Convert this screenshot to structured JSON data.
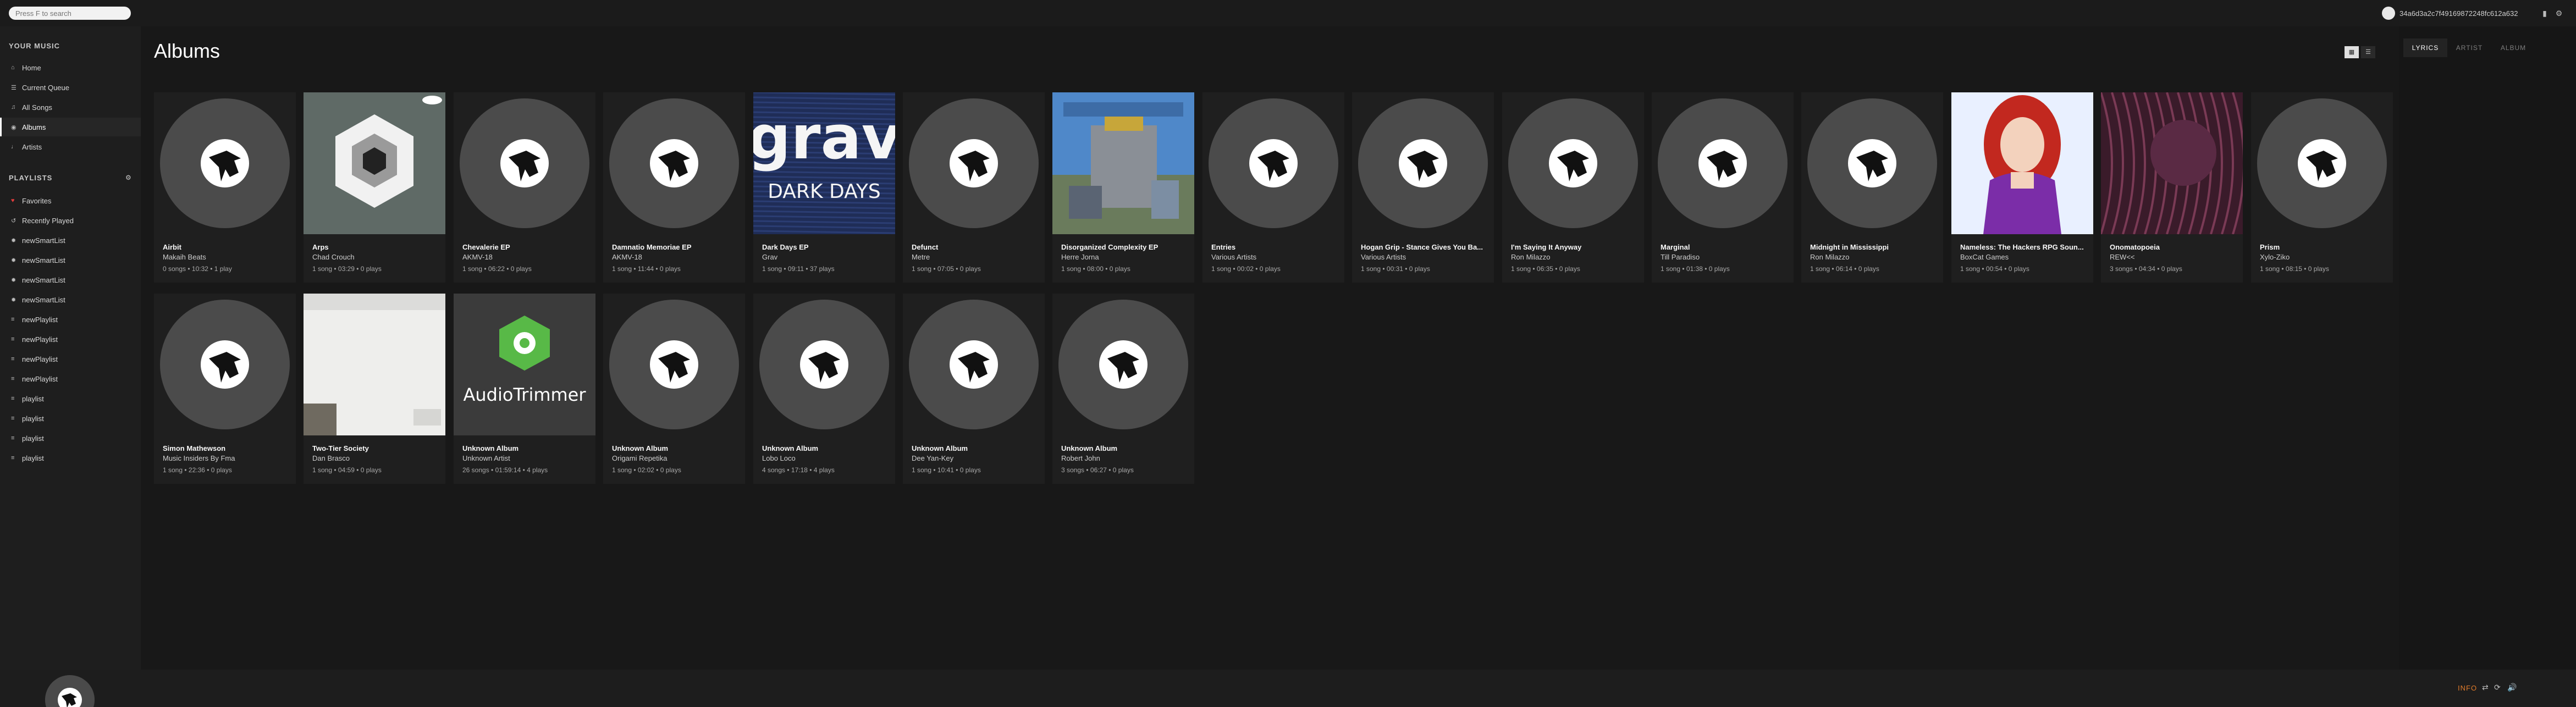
{
  "search": {
    "placeholder": "Press F to search"
  },
  "user": {
    "name": "34a6d3a2c7f49169872248fc612a632"
  },
  "sidebar": {
    "your_music_heading": "YOUR MUSIC",
    "music_items": [
      {
        "label": "Home",
        "icon": "home-icon"
      },
      {
        "label": "Current Queue",
        "icon": "queue-icon"
      },
      {
        "label": "All Songs",
        "icon": "music-note-icon"
      },
      {
        "label": "Albums",
        "icon": "album-icon",
        "active": true
      },
      {
        "label": "Artists",
        "icon": "microphone-icon"
      }
    ],
    "playlists_heading": "PLAYLISTS",
    "playlist_items": [
      {
        "label": "Favorites",
        "icon": "heart-icon"
      },
      {
        "label": "Recently Played",
        "icon": "history-icon"
      },
      {
        "label": "newSmartList",
        "icon": "smart-list-icon"
      },
      {
        "label": "newSmartList",
        "icon": "smart-list-icon"
      },
      {
        "label": "newSmartList",
        "icon": "smart-list-icon"
      },
      {
        "label": "newSmartList",
        "icon": "smart-list-icon"
      },
      {
        "label": "newPlaylist",
        "icon": "playlist-icon"
      },
      {
        "label": "newPlaylist",
        "icon": "playlist-icon"
      },
      {
        "label": "newPlaylist",
        "icon": "playlist-icon"
      },
      {
        "label": "newPlaylist",
        "icon": "playlist-icon"
      },
      {
        "label": "playlist",
        "icon": "playlist-icon"
      },
      {
        "label": "playlist",
        "icon": "playlist-icon"
      },
      {
        "label": "playlist",
        "icon": "playlist-icon"
      },
      {
        "label": "playlist",
        "icon": "playlist-icon"
      }
    ]
  },
  "main": {
    "title": "Albums",
    "albums": [
      {
        "title": "Airbit",
        "artist": "Makaih Beats",
        "meta": "0 songs • 10:32 • 1 play",
        "cover": "placeholder"
      },
      {
        "title": "Arps",
        "artist": "Chad Crouch",
        "meta": "1 song • 03:29 • 0 plays",
        "cover": "arps"
      },
      {
        "title": "Chevalerie EP",
        "artist": "AKMV-18",
        "meta": "1 song • 06:22 • 0 plays",
        "cover": "placeholder"
      },
      {
        "title": "Damnatio Memoriae EP",
        "artist": "AKMV-18",
        "meta": "1 song • 11:44 • 0 plays",
        "cover": "placeholder"
      },
      {
        "title": "Dark Days EP",
        "artist": "Grav",
        "meta": "1 song • 09:11 • 37 plays",
        "cover": "darkdays",
        "cover_text_top": "grav",
        "cover_text_bottom": "DARK DAYS"
      },
      {
        "title": "Defunct",
        "artist": "Metre",
        "meta": "1 song • 07:05 • 0 plays",
        "cover": "placeholder"
      },
      {
        "title": "Disorganized Complexity EP",
        "artist": "Herre Jorna",
        "meta": "1 song • 08:00 • 0 plays",
        "cover": "disorganized"
      },
      {
        "title": "Entries",
        "artist": "Various Artists",
        "meta": "1 song • 00:02 • 0 plays",
        "cover": "placeholder"
      },
      {
        "title": "Hogan Grip - Stance Gives You Ba...",
        "artist": "Various Artists",
        "meta": "1 song • 00:31 • 0 plays",
        "cover": "placeholder"
      },
      {
        "title": "I'm Saying It Anyway",
        "artist": "Ron Milazzo",
        "meta": "1 song • 06:35 • 0 plays",
        "cover": "placeholder"
      },
      {
        "title": "Marginal",
        "artist": "Till Paradiso",
        "meta": "1 song • 01:38 • 0 plays",
        "cover": "placeholder"
      },
      {
        "title": "Midnight in Mississippi",
        "artist": "Ron Milazzo",
        "meta": "1 song • 06:14 • 0 plays",
        "cover": "placeholder"
      },
      {
        "title": "Nameless: The Hackers RPG Soun...",
        "artist": "BoxCat Games",
        "meta": "1 song • 00:54 • 0 plays",
        "cover": "nameless"
      },
      {
        "title": "Onomatopoeia",
        "artist": "REW<<",
        "meta": "3 songs • 04:34 • 0 plays",
        "cover": "onomatopoeia"
      },
      {
        "title": "Prism",
        "artist": "Xylo-Ziko",
        "meta": "1 song • 08:15 • 0 plays",
        "cover": "placeholder"
      },
      {
        "title": "Simon Mathewson",
        "artist": "Music Insiders By Fma",
        "meta": "1 song • 22:36 • 0 plays",
        "cover": "placeholder"
      },
      {
        "title": "Two-Tier Society",
        "artist": "Dan Brasco",
        "meta": "1 song • 04:59 • 0 plays",
        "cover": "twotier"
      },
      {
        "title": "Unknown Album",
        "artist": "Unknown Artist",
        "meta": "26 songs • 01:59:14 • 4 plays",
        "cover": "audiotrimmer",
        "cover_text": "AudioTrimmer"
      },
      {
        "title": "Unknown Album",
        "artist": "Origami Repetika",
        "meta": "1 song • 02:02 • 0 plays",
        "cover": "placeholder"
      },
      {
        "title": "Unknown Album",
        "artist": "Lobo Loco",
        "meta": "4 songs • 17:18 • 4 plays",
        "cover": "placeholder"
      },
      {
        "title": "Unknown Album",
        "artist": "Dee Yan-Key",
        "meta": "1 song • 10:41 • 0 plays",
        "cover": "placeholder"
      },
      {
        "title": "Unknown Album",
        "artist": "Robert John",
        "meta": "3 songs • 06:27 • 0 plays",
        "cover": "placeholder"
      }
    ]
  },
  "right_panel": {
    "tabs": [
      {
        "label": "LYRICS",
        "active": true
      },
      {
        "label": "ARTIST",
        "active": false
      },
      {
        "label": "ALBUM",
        "active": false
      }
    ]
  },
  "footer": {
    "info_label": "INFO"
  },
  "colors": {
    "accent_orange": "#e07b2a",
    "favorite_red": "#e03c3c",
    "background": "#181818"
  }
}
